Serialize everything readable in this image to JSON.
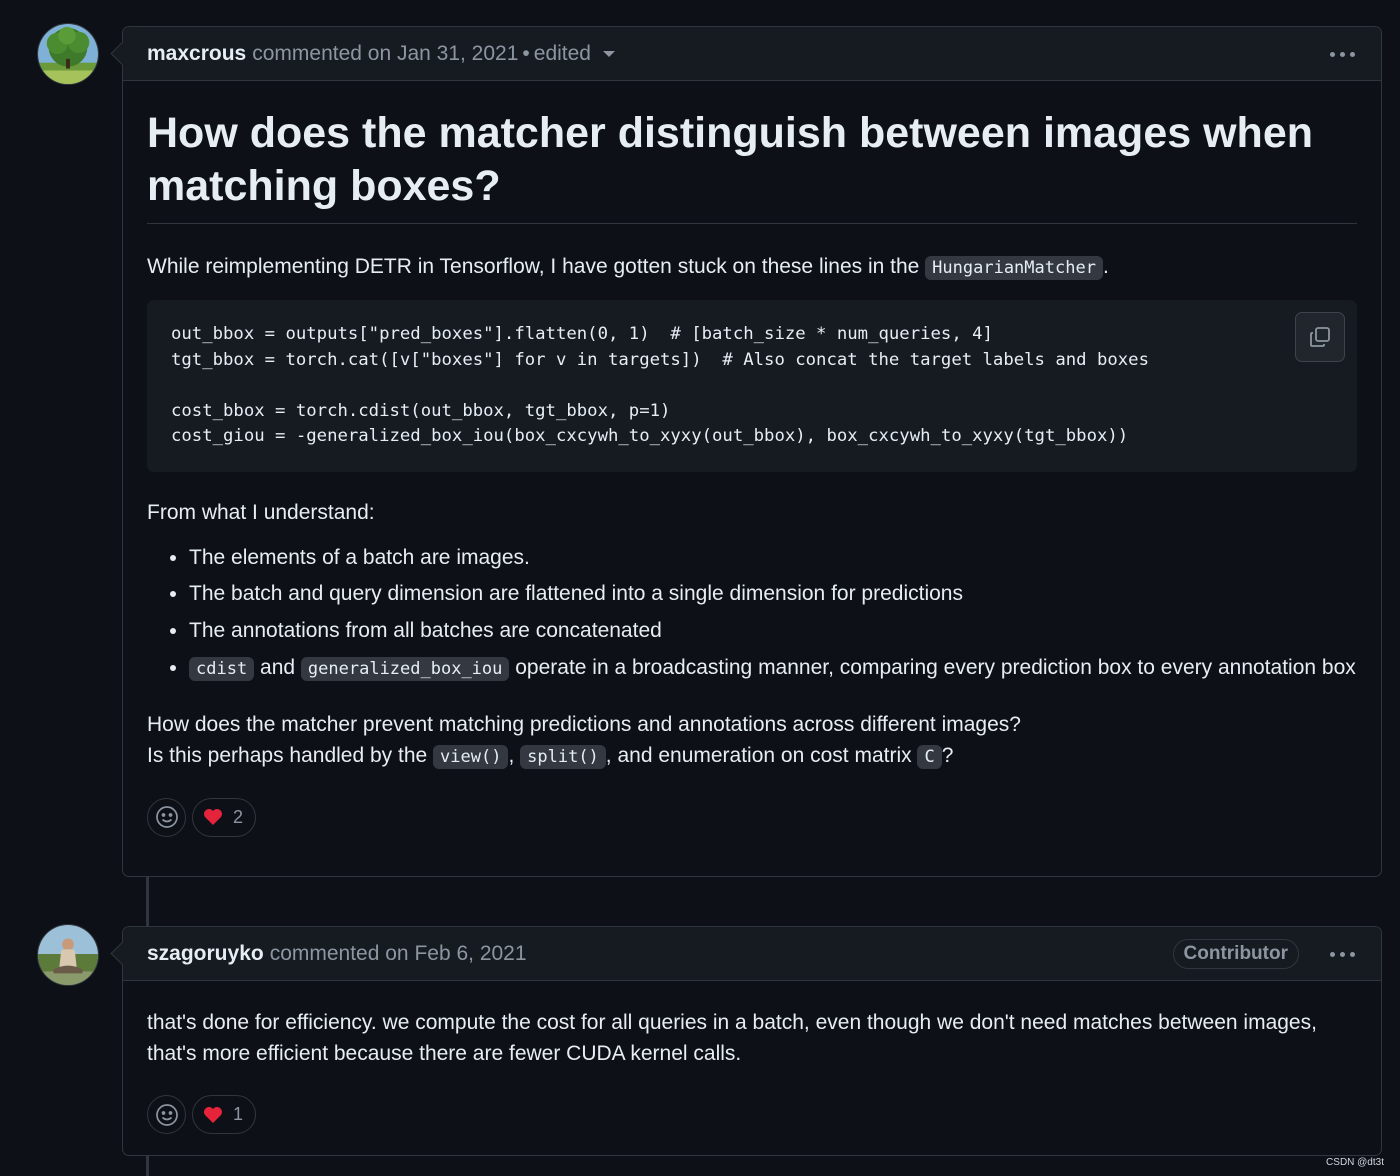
{
  "comments": [
    {
      "author": "maxcrous",
      "meta": "commented on Jan 31, 2021",
      "edited": "edited",
      "title": "How does the matcher distinguish between images when matching boxes?",
      "intro_before": "While reimplementing DETR in Tensorflow, I have gotten stuck on these lines in the ",
      "intro_code": "HungarianMatcher",
      "intro_after": ".",
      "code_lines": [
        "out_bbox = outputs[\"pred_boxes\"].flatten(0, 1)  # [batch_size * num_queries, 4]",
        "tgt_bbox = torch.cat([v[\"boxes\"] for v in targets])  # Also concat the target labels and boxes",
        "",
        "cost_bbox = torch.cdist(out_bbox, tgt_bbox, p=1)",
        "cost_giou = -generalized_box_iou(box_cxcywh_to_xyxy(out_bbox), box_cxcywh_to_xyxy(tgt_bbox))"
      ],
      "understand": "From what I understand:",
      "bullets": [
        "The elements of a batch are images.",
        "The batch and query dimension are flattened into a single dimension for predictions",
        "The annotations from all batches are concatenated"
      ],
      "bullet4": {
        "code1": "cdist",
        "and": "and",
        "code2": "generalized_box_iou",
        "rest": "operate in a broadcasting manner, comparing every prediction box to every annotation box"
      },
      "question1": "How does the matcher prevent matching predictions and annotations across different images?",
      "question2": {
        "prefix": "Is this perhaps handled by the",
        "code1": "view()",
        "code2": "split()",
        "middle": ", and enumeration on cost matrix",
        "code3": "C",
        "end": "?"
      },
      "heart_count": "2"
    },
    {
      "author": "szagoruyko",
      "meta": "commented on Feb 6, 2021",
      "badge": "Contributor",
      "line1": "that's done for efficiency. we compute the cost for all queries in a batch, even though we don't need matches between images,",
      "line2": "that's more efficient because there are fewer CUDA kernel calls.",
      "heart_count": "1"
    }
  ],
  "watermark": "CSDN @dt3t",
  "colors": {
    "bg": "#0d1117",
    "header": "#161b22",
    "border": "#30363d",
    "muted": "#8d96a0",
    "heart": "#e5243b"
  },
  "icons": [
    "copy-icon",
    "smiley-icon",
    "heart-icon",
    "kebab-icon",
    "caret-down-icon"
  ]
}
